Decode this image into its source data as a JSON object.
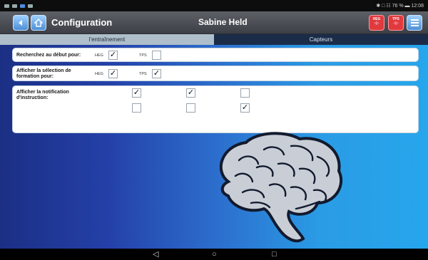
{
  "status_bar": {
    "right_text": "✱ □ ☷ 76 % ▬ 12:08"
  },
  "title_bar": {
    "title": "Configuration",
    "user": "Sabine Held",
    "heg_label": "HEG",
    "tps_label": "TPS"
  },
  "tabs": [
    {
      "label": "l'entraînement",
      "active": true
    },
    {
      "label": "Capteurs",
      "active": false
    }
  ],
  "settings": {
    "row1": {
      "label": "Recherchez au début pour:",
      "opt1": "HEG",
      "opt2": "TPS",
      "heg_checked": true,
      "tps_checked": false
    },
    "row2": {
      "label": "Afficher la sélection de formation pour:",
      "opt1": "HEG",
      "opt2": "TPS",
      "heg_checked": true,
      "tps_checked": true
    },
    "row3": {
      "label": "Afficher la notification d'instruction:",
      "grid": [
        [
          true,
          true,
          false
        ],
        [
          false,
          false,
          true
        ]
      ]
    }
  },
  "check_glyph": "✓",
  "colors": {
    "accent_blue": "#4d8fd6",
    "device_red": "#e0393e",
    "tab_active": "#aebecb",
    "tab_inactive": "#1b2c49"
  },
  "icons": [
    "back-arrow-icon",
    "home-icon",
    "heg-device-icon",
    "tps-device-icon",
    "menu-icon",
    "brain-illustration"
  ],
  "nav": {
    "back": "◁",
    "home": "○",
    "recent": "□"
  }
}
